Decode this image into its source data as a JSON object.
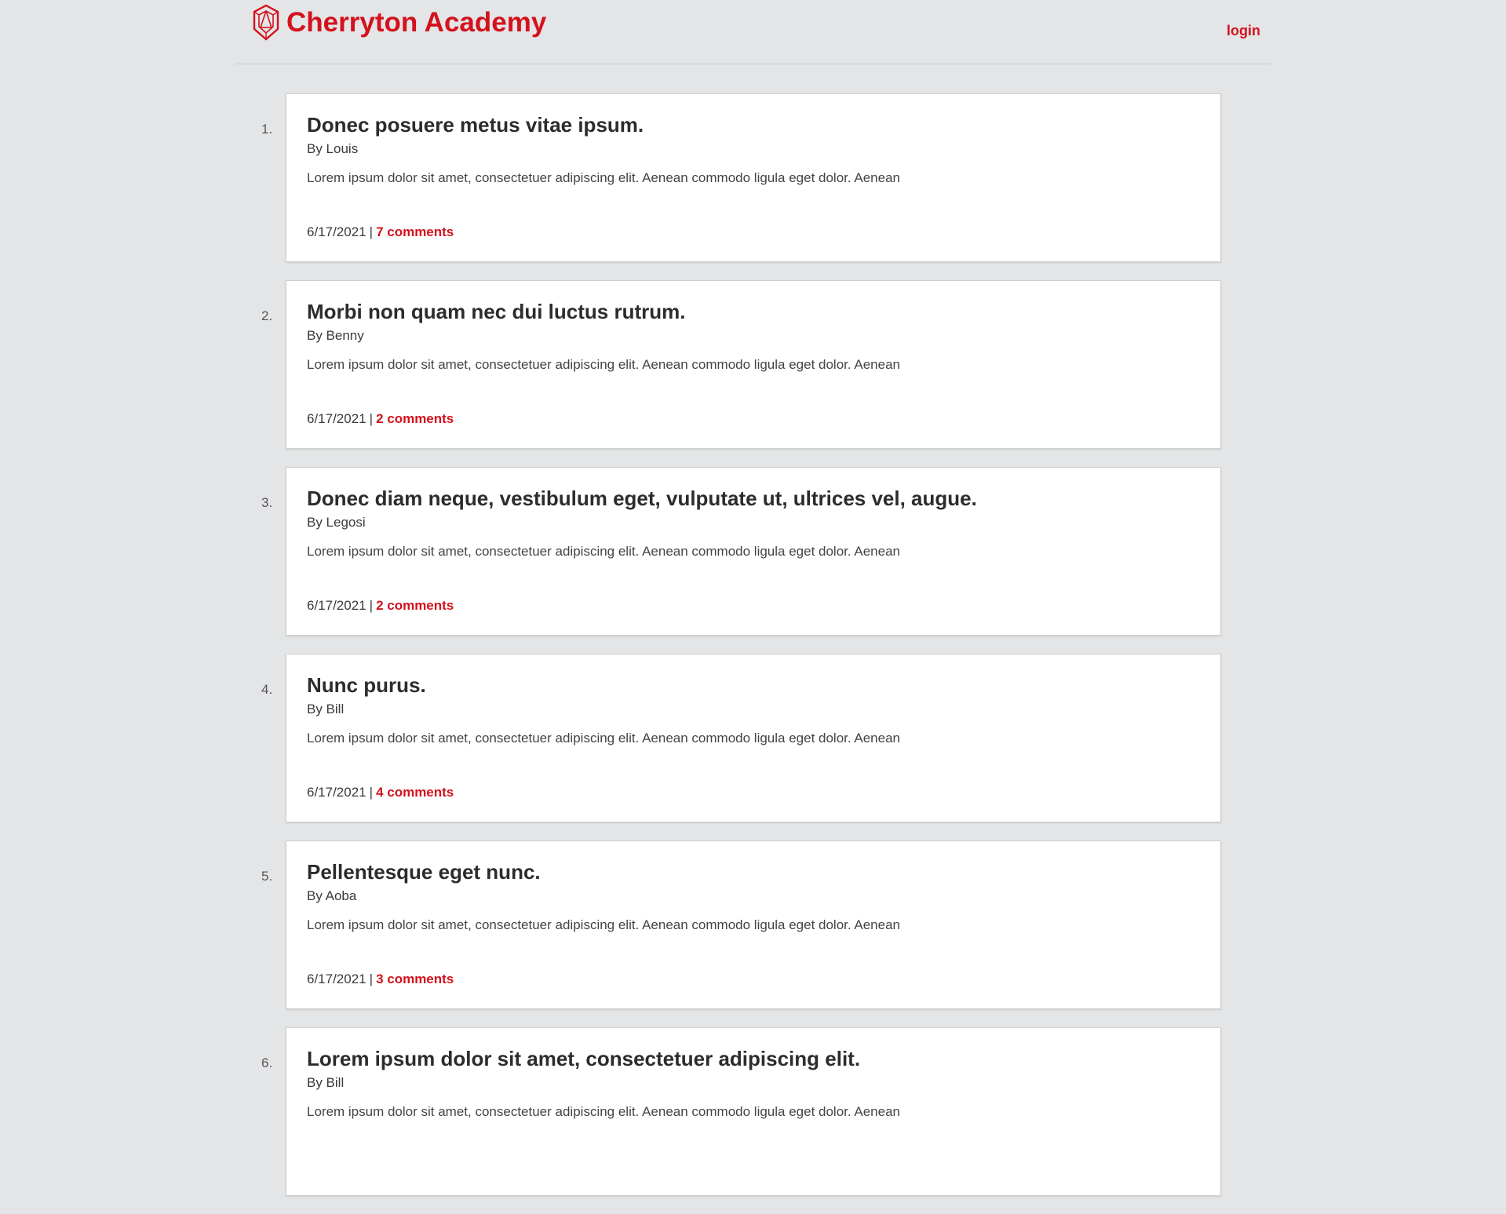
{
  "header": {
    "brand_name": "Cherryton Academy",
    "logo_icon": "shield-crest-icon",
    "login_label": "login",
    "accent_color": "#d3121d"
  },
  "posts": [
    {
      "index": "1.",
      "title": "Donec posuere metus vitae ipsum.",
      "author": "By Louis",
      "excerpt": "Lorem ipsum dolor sit amet, consectetuer adipiscing elit. Aenean commodo ligula eget dolor. Aenean",
      "date": "6/17/2021",
      "separator": "|",
      "comments": "7 comments"
    },
    {
      "index": "2.",
      "title": "Morbi non quam nec dui luctus rutrum.",
      "author": "By Benny",
      "excerpt": "Lorem ipsum dolor sit amet, consectetuer adipiscing elit. Aenean commodo ligula eget dolor. Aenean",
      "date": "6/17/2021",
      "separator": "|",
      "comments": "2 comments"
    },
    {
      "index": "3.",
      "title": "Donec diam neque, vestibulum eget, vulputate ut, ultrices vel, augue.",
      "author": "By Legosi",
      "excerpt": "Lorem ipsum dolor sit amet, consectetuer adipiscing elit. Aenean commodo ligula eget dolor. Aenean",
      "date": "6/17/2021",
      "separator": "|",
      "comments": "2 comments"
    },
    {
      "index": "4.",
      "title": "Nunc purus.",
      "author": "By Bill",
      "excerpt": "Lorem ipsum dolor sit amet, consectetuer adipiscing elit. Aenean commodo ligula eget dolor. Aenean",
      "date": "6/17/2021",
      "separator": "|",
      "comments": "4 comments"
    },
    {
      "index": "5.",
      "title": "Pellentesque eget nunc.",
      "author": "By Aoba",
      "excerpt": "Lorem ipsum dolor sit amet, consectetuer adipiscing elit. Aenean commodo ligula eget dolor. Aenean",
      "date": "6/17/2021",
      "separator": "|",
      "comments": "3 comments"
    },
    {
      "index": "6.",
      "title": "Lorem ipsum dolor sit amet, consectetuer adipiscing elit.",
      "author": "By Bill",
      "excerpt": "Lorem ipsum dolor sit amet, consectetuer adipiscing elit. Aenean commodo ligula eget dolor. Aenean",
      "date": "",
      "separator": "",
      "comments": ""
    }
  ]
}
